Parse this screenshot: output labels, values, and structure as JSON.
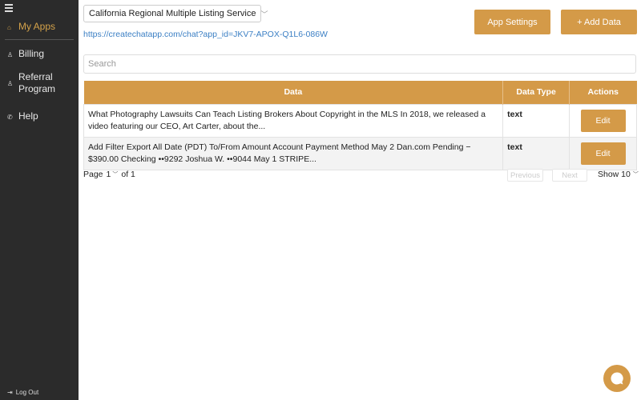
{
  "sidebar": {
    "items": [
      {
        "label": "My Apps",
        "icon": "home-icon"
      },
      {
        "label": "Billing",
        "icon": "user-icon"
      },
      {
        "label": "Referral Program",
        "icon": "user-icon"
      },
      {
        "label": "Help",
        "icon": "phone-icon"
      }
    ],
    "logout_label": "Log Out"
  },
  "header": {
    "app_selected": "California Regional Multiple Listing Service",
    "app_url": "https://createchatapp.com/chat?app_id=JKV7-APOX-Q1L6-086W",
    "settings_label": "App Settings",
    "add_data_label": "+ Add Data"
  },
  "search": {
    "placeholder": "Search"
  },
  "table": {
    "headers": [
      "Data",
      "Data Type",
      "Actions"
    ],
    "rows": [
      {
        "data": "What Photography Lawsuits Can Teach Listing Brokers About Copyright in the MLS In 2018, we released a video featuring our CEO, Art Carter, about the...",
        "type": "text",
        "action": "Edit"
      },
      {
        "data": "Add Filter Export All Date (PDT) To/From Amount Account Payment Method May 2 Dan.com Pending −$390.00 Checking ••9292 Joshua W. ••9044 May 1 STRIPE...",
        "type": "text",
        "action": "Edit"
      }
    ]
  },
  "pagination": {
    "page_label": "Page",
    "page_value": "1",
    "of_label": "of 1",
    "prev_label": "Previous",
    "next_label": "Next",
    "show_label": "Show 10"
  },
  "colors": {
    "accent": "#d49a48",
    "sidebar_bg": "#2b2b2b",
    "link": "#3b7fc4"
  }
}
